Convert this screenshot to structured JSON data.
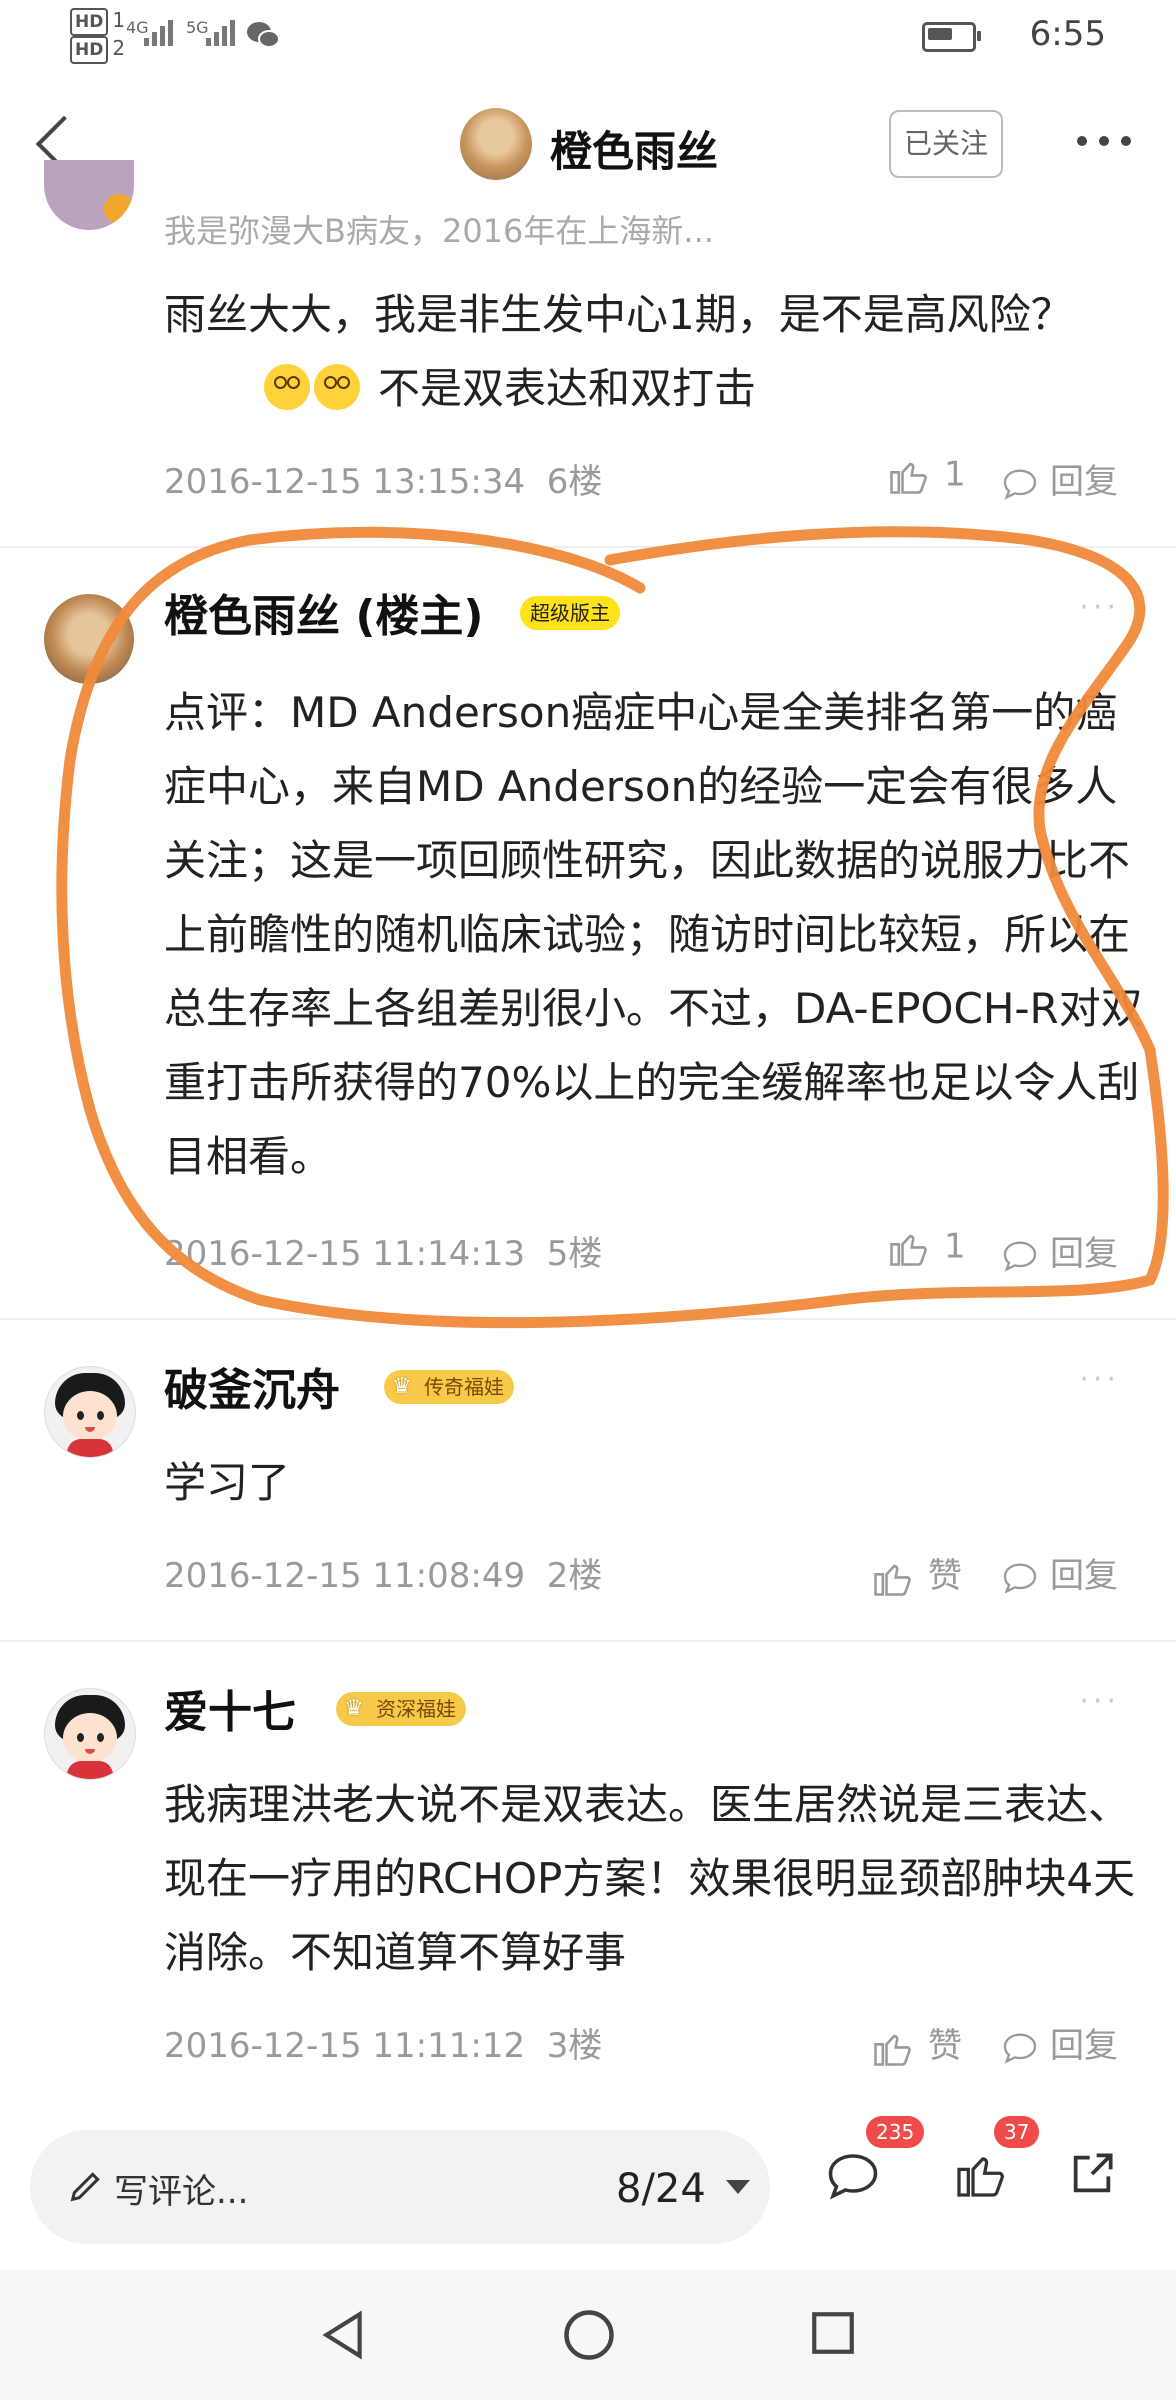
{
  "status_bar": {
    "hd1": "HD",
    "hd1_num": "1",
    "hd2": "HD",
    "hd2_num": "2",
    "network1": "4G",
    "network2": "5G",
    "time": "6:55"
  },
  "header": {
    "title": "橙色雨丝",
    "follow_label": "已关注",
    "avatar_icon": "dog-avatar",
    "back_icon": "back-arrow-icon",
    "more_icon": "more-dots-icon"
  },
  "partial_comment": {
    "text": "我是弥漫大B病友，2016年在上海新..."
  },
  "comments": [
    {
      "username": "",
      "body": "雨丝大大，我是非生发中心1期，是不是高风险？",
      "body_suffix": "不是双表达和双打击",
      "timestamp": "2016-12-15 13:15:34",
      "floor": "6楼",
      "like_label": "1",
      "reply_label": "回复"
    },
    {
      "username": "橙色雨丝 (楼主)",
      "badge": "超级版主",
      "body": "点评：MD Anderson癌症中心是全美排名第一的癌症中心，来自MD Anderson的经验一定会有很多人关注；这是一项回顾性研究，因此数据的说服力比不上前瞻性的随机临床试验；随访时间比较短，所以在总生存率上各组差别很小。不过，DA-EPOCH-R对双重打击所获得的70%以上的完全缓解率也足以令人刮目相看。",
      "timestamp": "2016-12-15 11:14:13",
      "floor": "5楼",
      "like_label": "1",
      "reply_label": "回复",
      "highlight_color": "#f08a3a"
    },
    {
      "username": "破釜沉舟",
      "badge": "传奇福娃",
      "body": "学习了",
      "timestamp": "2016-12-15 11:08:49",
      "floor": "2楼",
      "like_label": "赞",
      "reply_label": "回复"
    },
    {
      "username": "爱十七",
      "badge": "资深福娃",
      "body": "我病理洪老大说不是双表达。医生居然说是三表达、现在一疗用的RCHOP方案！效果很明显颈部肿块4天消除。不知道算不算好事",
      "timestamp": "2016-12-15 11:11:12",
      "floor": "3楼",
      "like_label": "赞",
      "reply_label": "回复"
    }
  ],
  "bottom_bar": {
    "input_label": "写评论...",
    "page_indicator": "8/24",
    "comment_count": "235",
    "like_count": "37",
    "comment_icon": "comment-bubble-icon",
    "like_icon": "thumb-up-icon",
    "share_icon": "share-icon"
  },
  "nav_bar": {
    "back_icon": "nav-back-triangle-icon",
    "home_icon": "nav-home-circle-icon",
    "recent_icon": "nav-recent-square-icon"
  },
  "colors": {
    "highlight": "#f08a3a",
    "badge_count": "#ef4b4b",
    "badge_super": "#ffe21a",
    "meta_gray": "#9a9a9a"
  }
}
